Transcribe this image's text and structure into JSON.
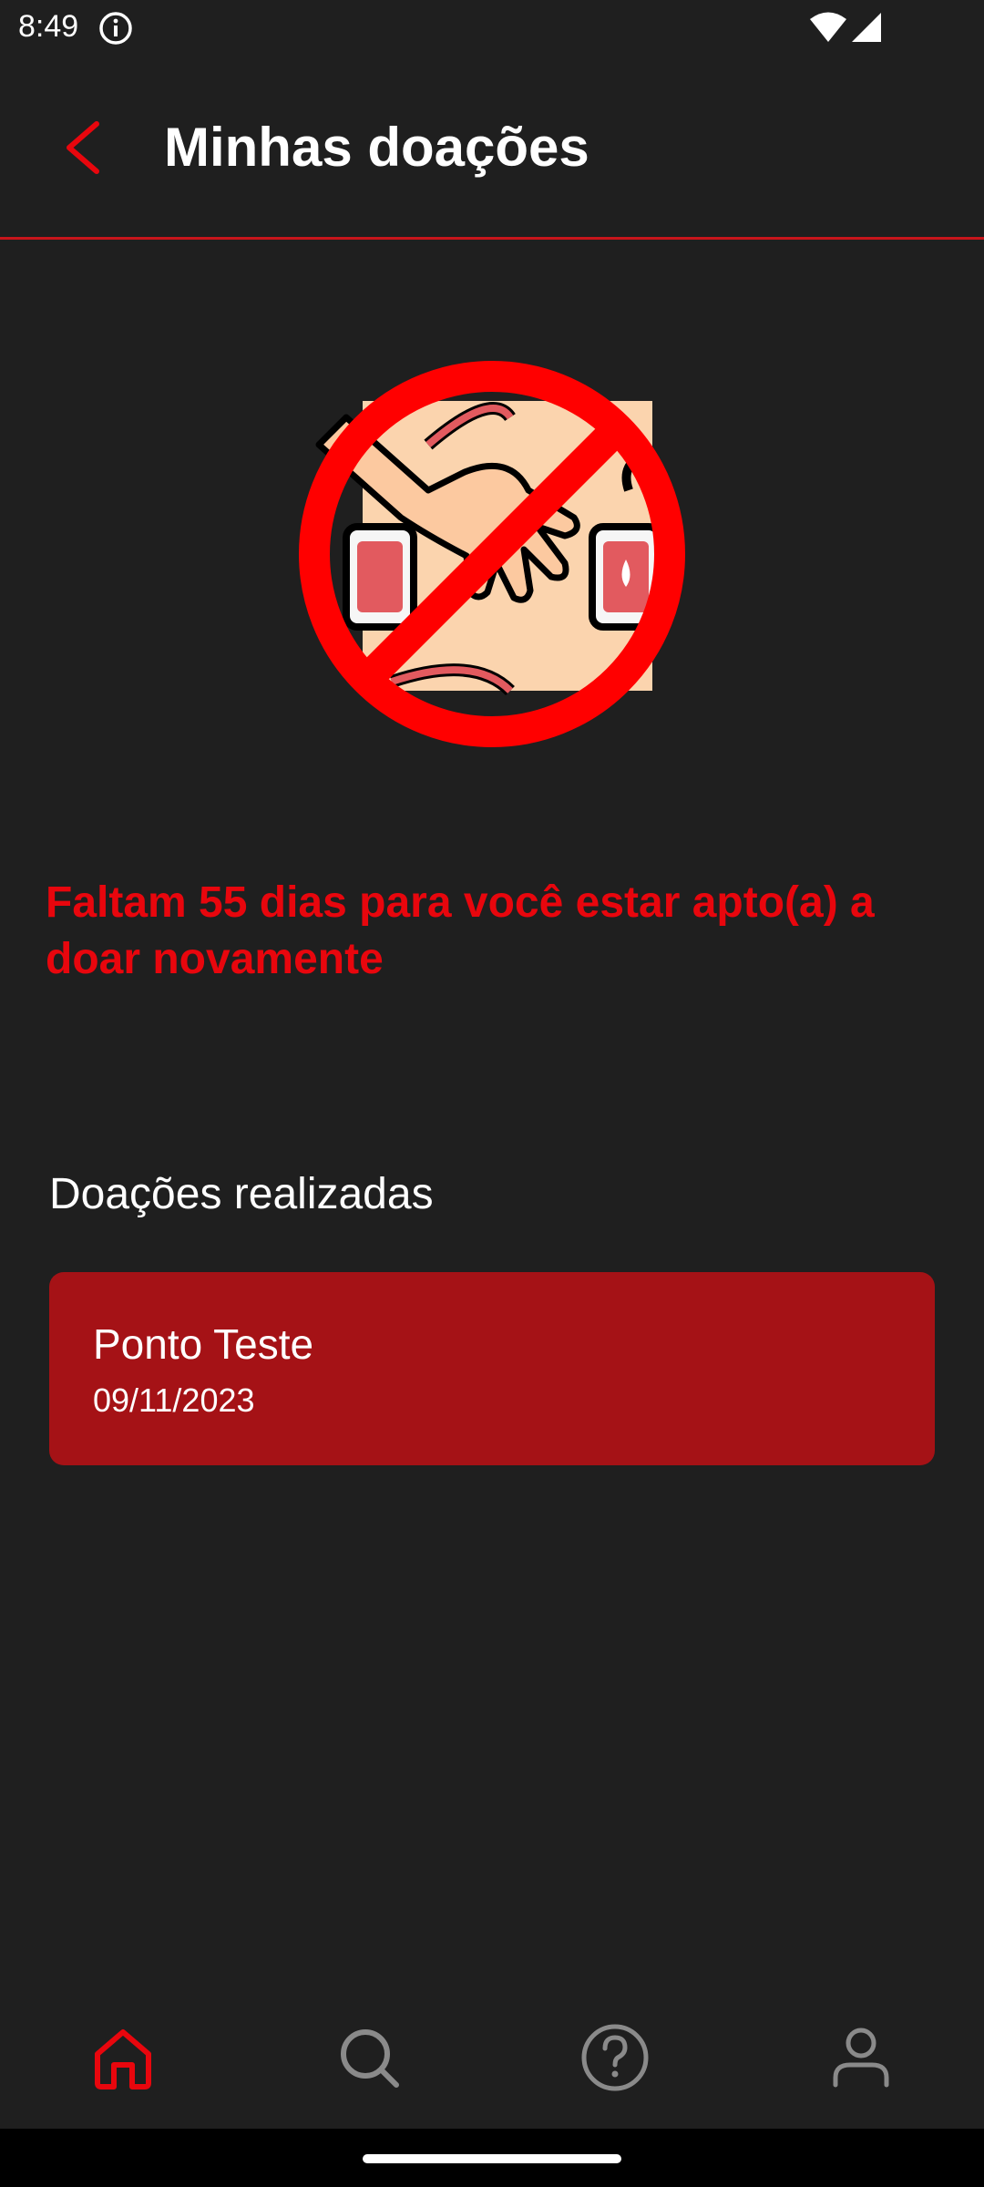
{
  "status_bar": {
    "time": "8:49",
    "icons": [
      "info-icon",
      "wifi-icon",
      "signal-icon"
    ]
  },
  "header": {
    "title": "Minhas doações",
    "back_icon": "chevron-left-icon"
  },
  "hero": {
    "icon": "no-blood-donation-icon"
  },
  "alert": {
    "message": "Faltam 55 dias para você estar apto(a) a doar novamente"
  },
  "donations": {
    "section_title": "Doações realizadas",
    "items": [
      {
        "place": "Ponto Teste",
        "date": "09/11/2023"
      }
    ]
  },
  "bottom_nav": {
    "items": [
      {
        "icon": "home-icon",
        "active": true
      },
      {
        "icon": "search-icon",
        "active": false
      },
      {
        "icon": "help-icon",
        "active": false
      },
      {
        "icon": "profile-icon",
        "active": false
      }
    ]
  },
  "colors": {
    "background": "#1f1f1f",
    "accent": "#e8060d",
    "card": "#a51216",
    "inactive_icon": "#8a8a8a"
  }
}
